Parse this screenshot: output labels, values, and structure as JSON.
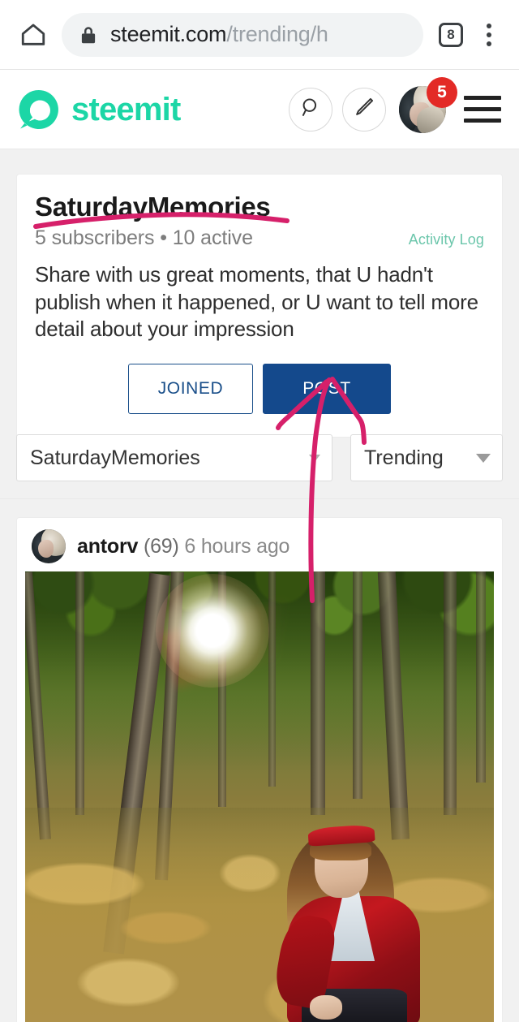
{
  "browser": {
    "home_icon": "home-icon",
    "lock_icon": "lock-icon",
    "url_host": "steemit.com",
    "url_path": "/trending/h",
    "tab_count": "8",
    "menu_icon": "kebab-menu-icon"
  },
  "header": {
    "brand": "steemit",
    "brand_color": "#1cd6a6",
    "search_icon": "search-icon",
    "compose_icon": "pencil-icon",
    "avatar": "user-avatar",
    "notification_count": "5",
    "notification_color": "#e32a26",
    "menu_icon": "hamburger-menu-icon"
  },
  "community": {
    "name": "SaturdayMemories",
    "stats": "5 subscribers  •  10 active",
    "activity_log": "Activity Log",
    "activity_log_color": "#6bc6ab",
    "description": "Share with us great moments, that U hadn't publish when it happened, or U want to tell more detail about your impression",
    "joined_label": "JOINED",
    "post_label": "POST",
    "post_button_color": "#14498c",
    "joined_button_color": "#1a4f8a"
  },
  "filters": {
    "community_select": "SaturdayMemories",
    "sort_select": "Trending",
    "caret_icon": "chevron-down-icon"
  },
  "post": {
    "author": "antorv",
    "reputation": "(69)",
    "timestamp": "6 hours ago",
    "image_alt": "woman-in-red-coat-in-autumn-forest"
  },
  "annotation": {
    "color": "#d6206a",
    "underline_target": "SaturdayMemories",
    "arrow_target": "POST"
  }
}
